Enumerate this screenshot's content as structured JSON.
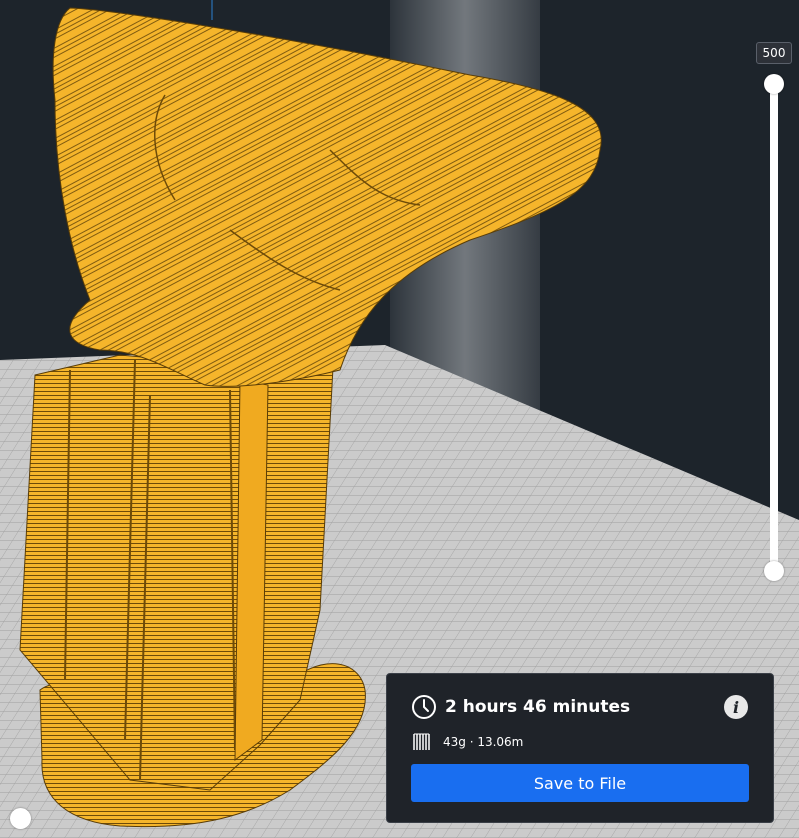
{
  "layer_slider": {
    "max_layer_label": "500",
    "current_layer": 500,
    "min_layer": 1
  },
  "simulation": {
    "progress": 0.0
  },
  "print_info": {
    "time": "2 hours 46 minutes",
    "material": "43g · 13.06m",
    "save_button_label": "Save to File"
  },
  "colors": {
    "model": "#f5b52b",
    "model_line": "#4a3305",
    "wall": "#1d242b",
    "build_plate": "#c9c9c9",
    "grid_line": "#9f9f9f",
    "save_button": "#196ef0",
    "panel_bg": "#1f2329"
  },
  "icons": {
    "time": "clock-icon",
    "material": "spool-icon",
    "info": "info-icon"
  }
}
